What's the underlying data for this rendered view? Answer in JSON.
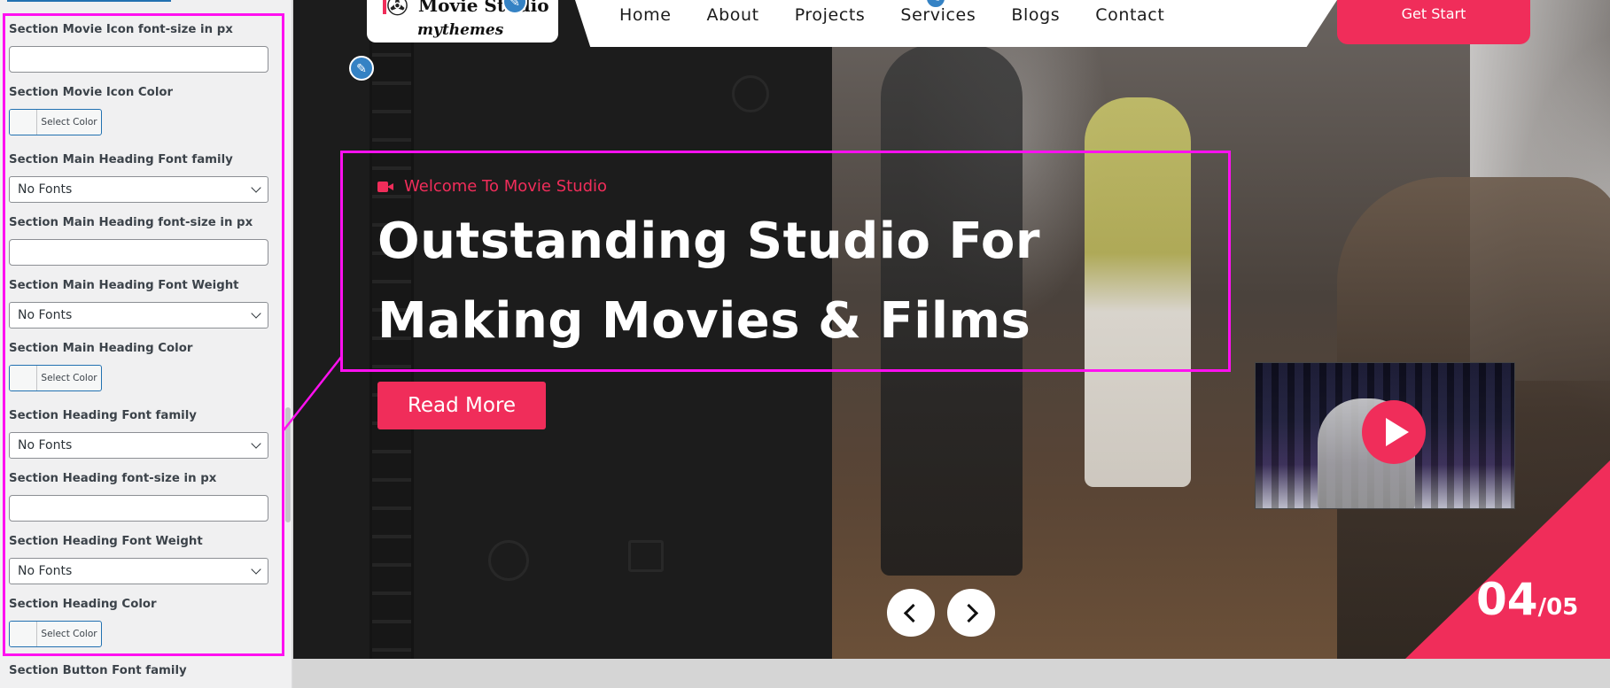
{
  "panel": {
    "fields": [
      {
        "label": "Section Movie Icon font-size in px",
        "type": "text",
        "value": ""
      },
      {
        "label": "Section Movie Icon Color",
        "type": "color",
        "button": "Select Color"
      },
      {
        "label": "Section Main Heading Font family",
        "type": "select",
        "value": "No Fonts"
      },
      {
        "label": "Section Main Heading font-size in px",
        "type": "text",
        "value": ""
      },
      {
        "label": "Section Main Heading Font Weight",
        "type": "select",
        "value": "No Fonts"
      },
      {
        "label": "Section Main Heading Color",
        "type": "color",
        "button": "Select Color"
      },
      {
        "label": "Section Heading Font family",
        "type": "select",
        "value": "No Fonts"
      },
      {
        "label": "Section Heading font-size in px",
        "type": "text",
        "value": ""
      },
      {
        "label": "Section Heading Font Weight",
        "type": "select",
        "value": "No Fonts"
      },
      {
        "label": "Section Heading Color",
        "type": "color",
        "button": "Select Color"
      },
      {
        "label": "Section Button Font family",
        "type": "label"
      }
    ]
  },
  "site": {
    "logo_name": "Movie Studio",
    "logo_tagline": "mythemes",
    "nav": [
      "Home",
      "About",
      "Projects",
      "Services",
      "Blogs",
      "Contact"
    ],
    "cta": "Get Start"
  },
  "hero": {
    "welcome": "Welcome To Movie Studio",
    "title": "Outstanding Studio For Making Movies & Films",
    "button": "Read More",
    "slide_current": "04",
    "slide_total": "/05"
  },
  "colors": {
    "accent": "#f02d5a",
    "highlight": "#ff10f0",
    "wp_blue": "#2271b1"
  }
}
